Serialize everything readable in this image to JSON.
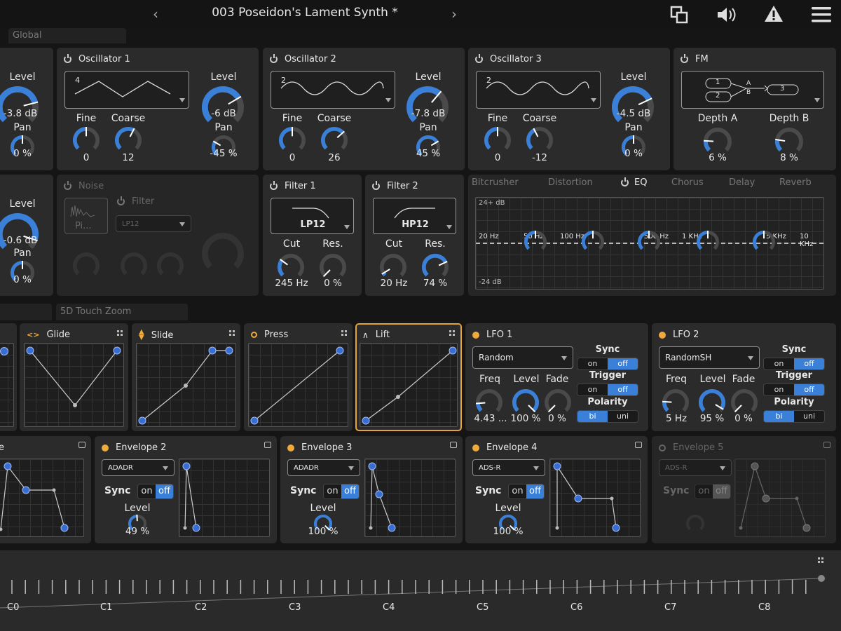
{
  "header": {
    "preset_name": "003 Poseidon's Lament Synth *",
    "prev": "‹",
    "next": "›",
    "global_tab": "Global"
  },
  "osc0": {
    "level_label": "Level",
    "level": "-3.8 dB",
    "pan_label": "Pan",
    "pan": "0 %"
  },
  "osc1": {
    "title": "Oscillator 1",
    "wave": "4",
    "fine_label": "Fine",
    "fine": "0",
    "coarse_label": "Coarse",
    "coarse": "12",
    "level_label": "Level",
    "level": "-6 dB",
    "pan_label": "Pan",
    "pan": "-45 %"
  },
  "osc2": {
    "title": "Oscillator 2",
    "wave": "2",
    "fine_label": "Fine",
    "fine": "0",
    "coarse_label": "Coarse",
    "coarse": "26",
    "level_label": "Level",
    "level": "-7.8 dB",
    "pan_label": "Pan",
    "pan": "45 %"
  },
  "osc3": {
    "title": "Oscillator 3",
    "wave": "2",
    "fine_label": "Fine",
    "fine": "0",
    "coarse_label": "Coarse",
    "coarse": "-12",
    "level_label": "Level",
    "level": "-4.5 dB",
    "pan_label": "Pan",
    "pan": "0 %"
  },
  "fm": {
    "title": "FM",
    "n1": "1",
    "n2": "2",
    "n3": "3",
    "a": "A",
    "b": "B",
    "depth_a_label": "Depth A",
    "depth_a": "6 %",
    "depth_b_label": "Depth B",
    "depth_b": "8 %"
  },
  "sub": {
    "level_label": "Level",
    "level": "-0.6 dB",
    "pan_label": "Pan",
    "pan": "0 %"
  },
  "noise": {
    "title": "Noise",
    "sample": "Pi...",
    "filter_title": "Filter",
    "filter_type": "LP12"
  },
  "filter1": {
    "title": "Filter 1",
    "type": "LP12",
    "cut_label": "Cut",
    "cut": "245 Hz",
    "res_label": "Res.",
    "res": "0 %"
  },
  "filter2": {
    "title": "Filter 2",
    "type": "HP12",
    "cut_label": "Cut",
    "cut": "20 Hz",
    "res_label": "Res.",
    "res": "74 %"
  },
  "fx": {
    "tabs": [
      "Bitcrusher",
      "Distortion",
      "EQ",
      "Chorus",
      "Delay",
      "Reverb"
    ],
    "top_db": "24+ dB",
    "bottom_db": "-24 dB",
    "freqs": [
      "20 Hz",
      "50 Hz",
      "100 Hz",
      "500 Hz",
      "1 KHz",
      "5 KHz",
      "10 KHz"
    ]
  },
  "touch_tab": "5D Touch Zoom",
  "mods": {
    "glide": "Glide",
    "slide": "Slide",
    "press": "Press",
    "lift": "Lift"
  },
  "lfo1": {
    "title": "LFO 1",
    "shape": "Random",
    "freq_label": "Freq",
    "freq": "4.43 ...",
    "level_label": "Level",
    "level": "100 %",
    "fade_label": "Fade",
    "fade": "0 %",
    "sync_label": "Sync",
    "trigger_label": "Trigger",
    "polarity_label": "Polarity",
    "on": "on",
    "off": "off",
    "bi": "bi",
    "uni": "uni"
  },
  "lfo2": {
    "title": "LFO 2",
    "shape": "RandomSH",
    "freq_label": "Freq",
    "freq": "5 Hz",
    "level_label": "Level",
    "level": "95 %",
    "fade_label": "Fade",
    "fade": "0 %",
    "sync_label": "Sync",
    "trigger_label": "Trigger",
    "polarity_label": "Polarity",
    "on": "on",
    "off": "off",
    "bi": "bi",
    "uni": "uni"
  },
  "env1": {
    "title": "e"
  },
  "env2": {
    "title": "Envelope 2",
    "mode": "ADADR",
    "sync_label": "Sync",
    "on": "on",
    "off": "off",
    "level_label": "Level",
    "level": "49 %"
  },
  "env3": {
    "title": "Envelope 3",
    "mode": "ADADR",
    "sync_label": "Sync",
    "on": "on",
    "off": "off",
    "level_label": "Level",
    "level": "100 %"
  },
  "env4": {
    "title": "Envelope 4",
    "mode": "ADS-R",
    "sync_label": "Sync",
    "on": "on",
    "off": "off",
    "level_label": "Level",
    "level": "100 %"
  },
  "env5": {
    "title": "Envelope 5",
    "mode": "ADS-R",
    "sync_label": "Sync",
    "on": "on",
    "off": "off"
  },
  "keyboard": {
    "notes": [
      "C0",
      "C1",
      "C2",
      "C3",
      "C4",
      "C5",
      "C6",
      "C7",
      "C8"
    ]
  },
  "colors": {
    "accent": "#3a80d9",
    "knob_track": "#4a4a4a",
    "highlight": "#f0a93b"
  }
}
